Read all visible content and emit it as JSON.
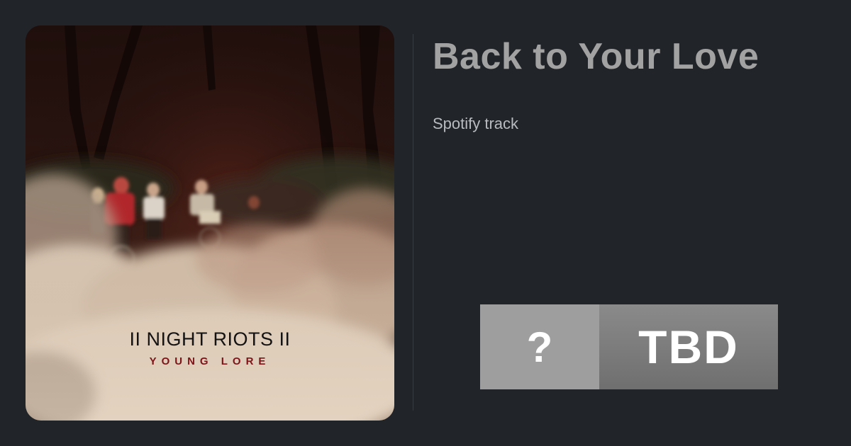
{
  "track": {
    "title": "Back to Your Love",
    "subtitle": "Spotify track"
  },
  "cover": {
    "band_name": "II NIGHT RIOTS II",
    "album_name": "YOUNG LORE"
  },
  "badge": {
    "left_text": "?",
    "right_text": "TBD",
    "left_color": "#9e9e9e",
    "right_color": "#7c7c7c"
  },
  "colors": {
    "background": "#212429",
    "title": "#a2a2a2",
    "subtitle": "#b8bbbf",
    "album_accent": "#7c1418"
  }
}
